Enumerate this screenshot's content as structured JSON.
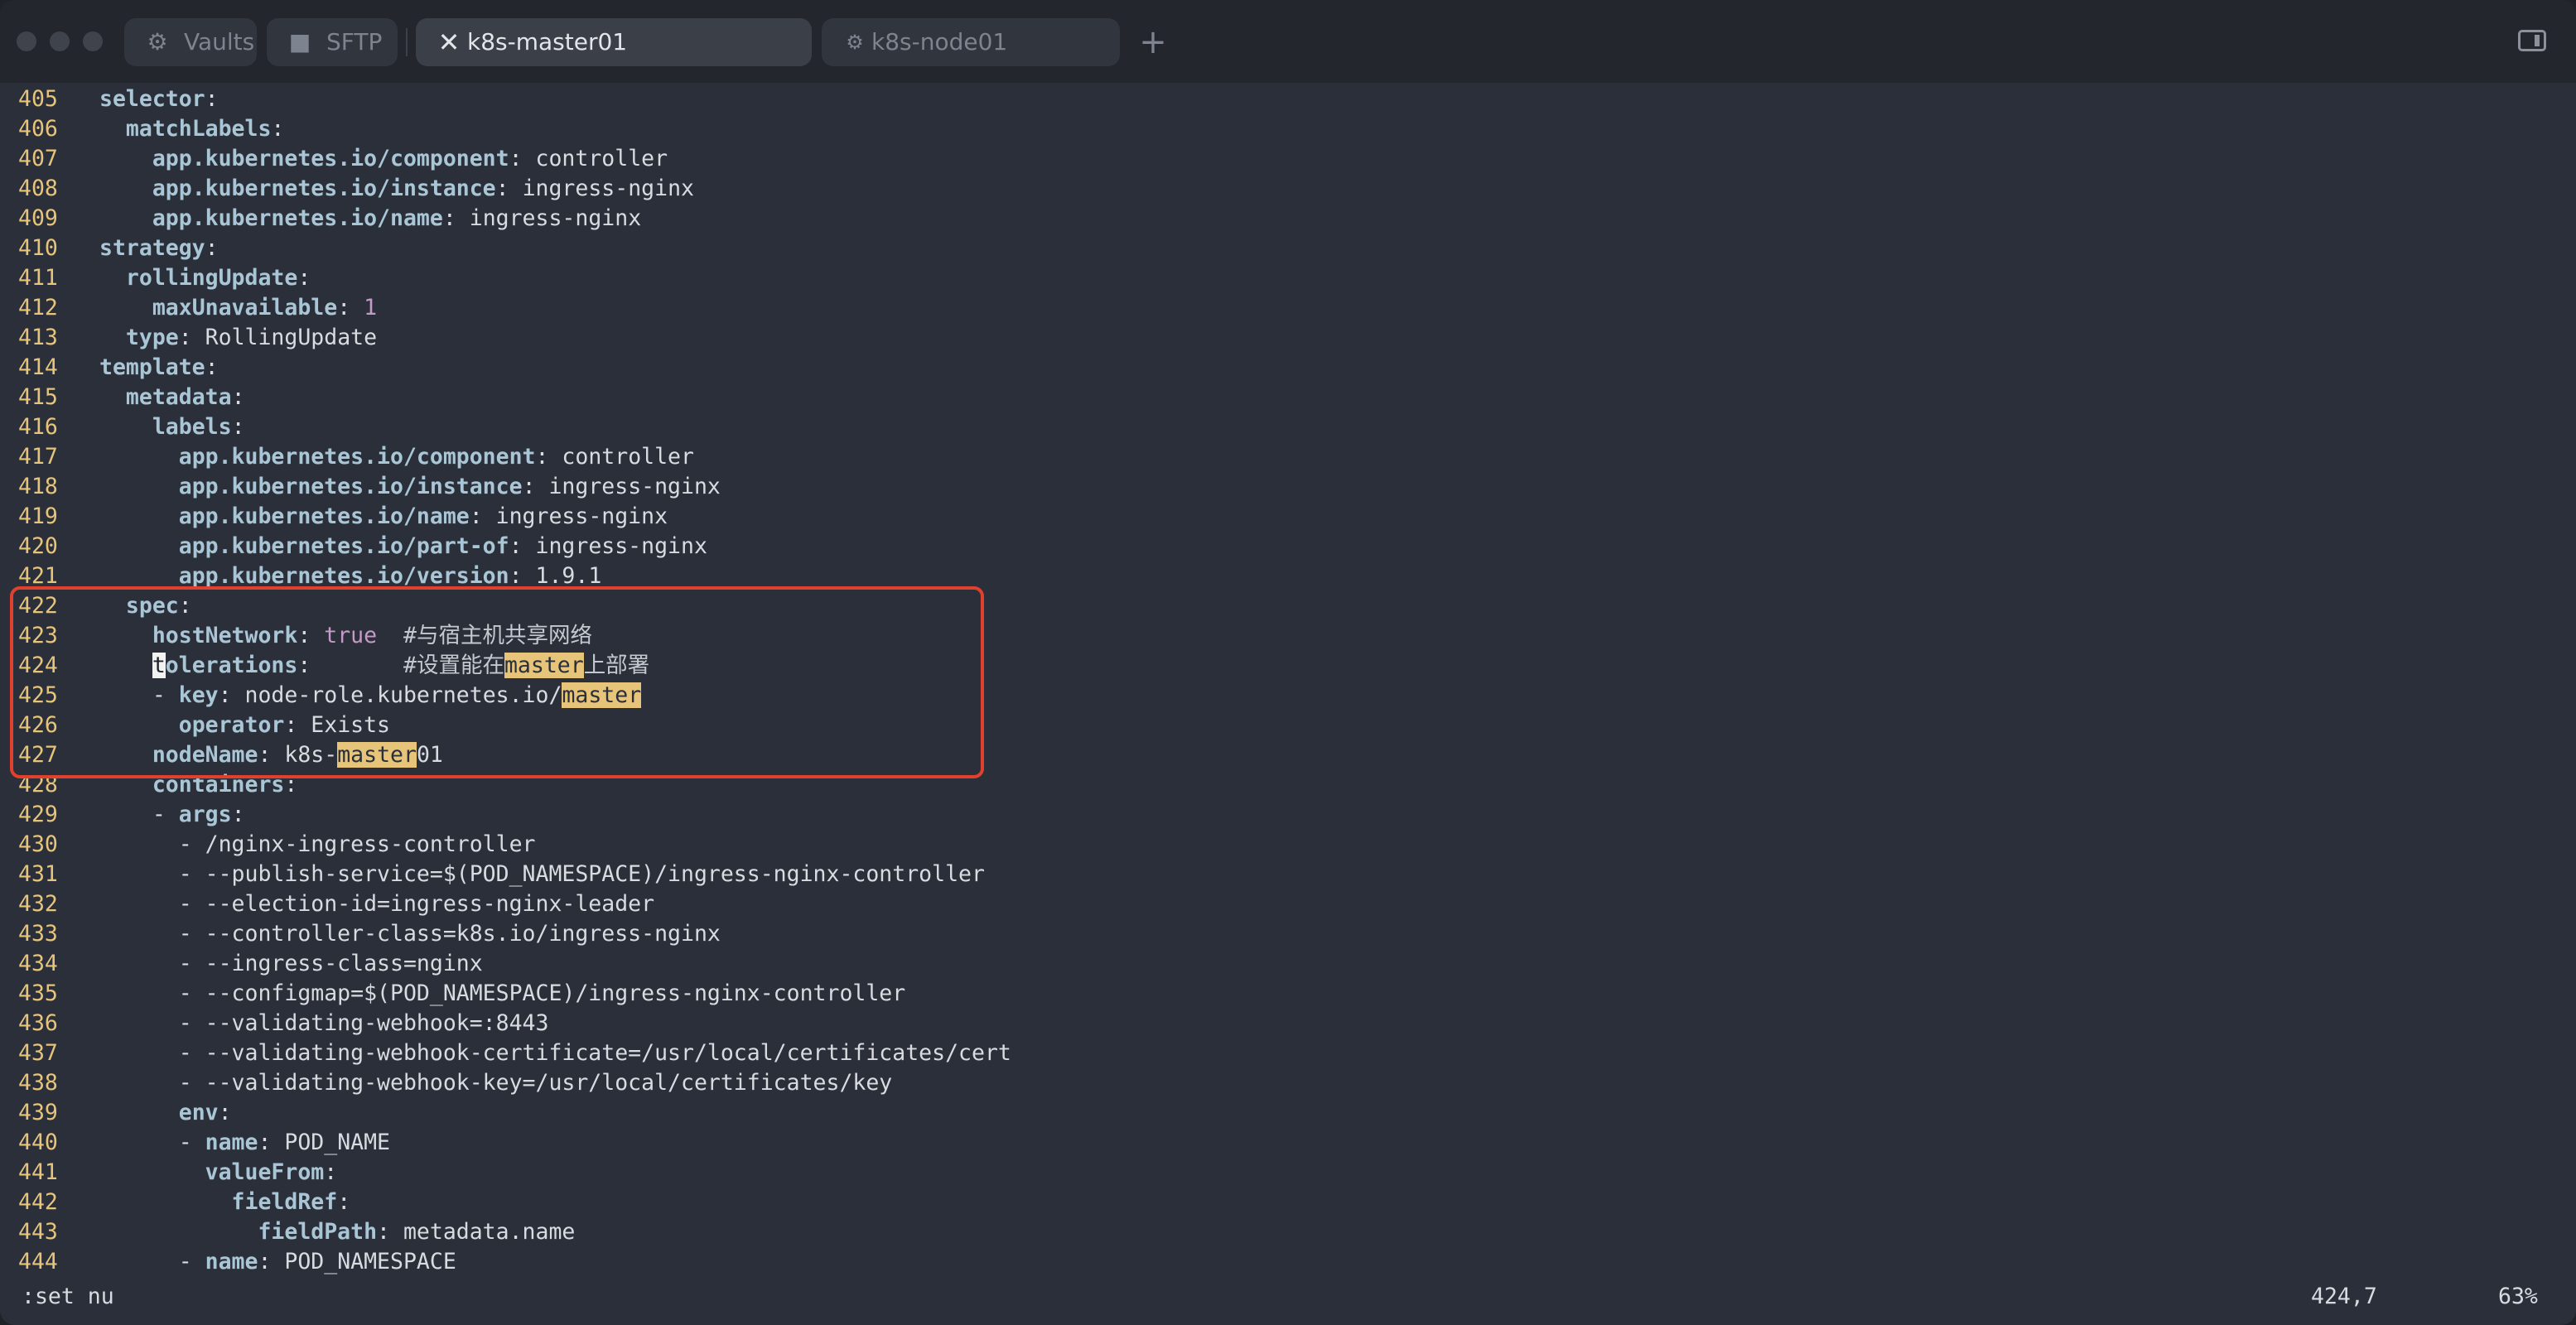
{
  "tabs": [
    {
      "label": "Vaults",
      "icon": "vault-icon"
    },
    {
      "label": "SFTP",
      "icon": "folder-icon"
    },
    {
      "label": "k8s-master01",
      "icon": "close-icon",
      "active": true
    },
    {
      "label": "k8s-node01",
      "icon": "gear-icon"
    }
  ],
  "lines": [
    {
      "n": "405",
      "segs": [
        [
          "k",
          "selector"
        ],
        [
          "p",
          ":"
        ]
      ]
    },
    {
      "n": "406",
      "segs": [
        [
          "p",
          "  "
        ],
        [
          "k",
          "matchLabels"
        ],
        [
          "p",
          ":"
        ]
      ]
    },
    {
      "n": "407",
      "segs": [
        [
          "p",
          "    "
        ],
        [
          "k",
          "app.kubernetes.io/component"
        ],
        [
          "p",
          ": controller"
        ]
      ]
    },
    {
      "n": "408",
      "segs": [
        [
          "p",
          "    "
        ],
        [
          "k",
          "app.kubernetes.io/instance"
        ],
        [
          "p",
          ": ingress-nginx"
        ]
      ]
    },
    {
      "n": "409",
      "segs": [
        [
          "p",
          "    "
        ],
        [
          "k",
          "app.kubernetes.io/name"
        ],
        [
          "p",
          ": ingress-nginx"
        ]
      ]
    },
    {
      "n": "410",
      "segs": [
        [
          "k",
          "strategy"
        ],
        [
          "p",
          ":"
        ]
      ]
    },
    {
      "n": "411",
      "segs": [
        [
          "p",
          "  "
        ],
        [
          "k",
          "rollingUpdate"
        ],
        [
          "p",
          ":"
        ]
      ]
    },
    {
      "n": "412",
      "segs": [
        [
          "p",
          "    "
        ],
        [
          "k",
          "maxUnavailable"
        ],
        [
          "p",
          ": "
        ],
        [
          "num",
          "1"
        ]
      ]
    },
    {
      "n": "413",
      "segs": [
        [
          "p",
          "  "
        ],
        [
          "k",
          "type"
        ],
        [
          "p",
          ": RollingUpdate"
        ]
      ]
    },
    {
      "n": "414",
      "segs": [
        [
          "k",
          "template"
        ],
        [
          "p",
          ":"
        ]
      ]
    },
    {
      "n": "415",
      "segs": [
        [
          "p",
          "  "
        ],
        [
          "k",
          "metadata"
        ],
        [
          "p",
          ":"
        ]
      ]
    },
    {
      "n": "416",
      "segs": [
        [
          "p",
          "    "
        ],
        [
          "k",
          "labels"
        ],
        [
          "p",
          ":"
        ]
      ]
    },
    {
      "n": "417",
      "segs": [
        [
          "p",
          "      "
        ],
        [
          "k",
          "app.kubernetes.io/component"
        ],
        [
          "p",
          ": controller"
        ]
      ]
    },
    {
      "n": "418",
      "segs": [
        [
          "p",
          "      "
        ],
        [
          "k",
          "app.kubernetes.io/instance"
        ],
        [
          "p",
          ": ingress-nginx"
        ]
      ]
    },
    {
      "n": "419",
      "segs": [
        [
          "p",
          "      "
        ],
        [
          "k",
          "app.kubernetes.io/name"
        ],
        [
          "p",
          ": ingress-nginx"
        ]
      ]
    },
    {
      "n": "420",
      "segs": [
        [
          "p",
          "      "
        ],
        [
          "k",
          "app.kubernetes.io/part-of"
        ],
        [
          "p",
          ": ingress-nginx"
        ]
      ]
    },
    {
      "n": "421",
      "segs": [
        [
          "p",
          "      "
        ],
        [
          "k",
          "app.kubernetes.io/version"
        ],
        [
          "p",
          ": 1.9.1"
        ]
      ]
    },
    {
      "n": "422",
      "segs": [
        [
          "p",
          "  "
        ],
        [
          "k",
          "spec"
        ],
        [
          "p",
          ":"
        ]
      ]
    },
    {
      "n": "423",
      "segs": [
        [
          "p",
          "    "
        ],
        [
          "k",
          "hostNetwork"
        ],
        [
          "p",
          ": "
        ],
        [
          "bool",
          "true"
        ],
        [
          "p",
          "  "
        ],
        [
          "c",
          "#与宿主机共享网络"
        ]
      ]
    },
    {
      "n": "424",
      "segs": [
        [
          "p",
          "    "
        ],
        [
          "cur",
          "t"
        ],
        [
          "k",
          "olerations"
        ],
        [
          "p",
          ":       "
        ],
        [
          "c",
          "#设置能在"
        ],
        [
          "hl",
          "master"
        ],
        [
          "c",
          "上部署"
        ]
      ]
    },
    {
      "n": "425",
      "segs": [
        [
          "p",
          "    - "
        ],
        [
          "k",
          "key"
        ],
        [
          "p",
          ": node-role.kubernetes.io/"
        ],
        [
          "hl",
          "master"
        ]
      ]
    },
    {
      "n": "426",
      "segs": [
        [
          "p",
          "      "
        ],
        [
          "k",
          "operator"
        ],
        [
          "p",
          ": Exists"
        ]
      ]
    },
    {
      "n": "427",
      "segs": [
        [
          "p",
          "    "
        ],
        [
          "k",
          "nodeName"
        ],
        [
          "p",
          ": k8s-"
        ],
        [
          "hl",
          "master"
        ],
        [
          "p",
          "01"
        ]
      ]
    },
    {
      "n": "428",
      "segs": [
        [
          "p",
          "    "
        ],
        [
          "k",
          "containers"
        ],
        [
          "p",
          ":"
        ]
      ]
    },
    {
      "n": "429",
      "segs": [
        [
          "p",
          "    - "
        ],
        [
          "k",
          "args"
        ],
        [
          "p",
          ":"
        ]
      ]
    },
    {
      "n": "430",
      "segs": [
        [
          "p",
          "      - /nginx-ingress-controller"
        ]
      ]
    },
    {
      "n": "431",
      "segs": [
        [
          "p",
          "      - --publish-service=$(POD_NAMESPACE)/ingress-nginx-controller"
        ]
      ]
    },
    {
      "n": "432",
      "segs": [
        [
          "p",
          "      - --election-id=ingress-nginx-leader"
        ]
      ]
    },
    {
      "n": "433",
      "segs": [
        [
          "p",
          "      - --controller-class=k8s.io/ingress-nginx"
        ]
      ]
    },
    {
      "n": "434",
      "segs": [
        [
          "p",
          "      - --ingress-class=nginx"
        ]
      ]
    },
    {
      "n": "435",
      "segs": [
        [
          "p",
          "      - --configmap=$(POD_NAMESPACE)/ingress-nginx-controller"
        ]
      ]
    },
    {
      "n": "436",
      "segs": [
        [
          "p",
          "      - --validating-webhook=:8443"
        ]
      ]
    },
    {
      "n": "437",
      "segs": [
        [
          "p",
          "      - --validating-webhook-certificate=/usr/local/certificates/cert"
        ]
      ]
    },
    {
      "n": "438",
      "segs": [
        [
          "p",
          "      - --validating-webhook-key=/usr/local/certificates/key"
        ]
      ]
    },
    {
      "n": "439",
      "segs": [
        [
          "p",
          "      "
        ],
        [
          "k",
          "env"
        ],
        [
          "p",
          ":"
        ]
      ]
    },
    {
      "n": "440",
      "segs": [
        [
          "p",
          "      - "
        ],
        [
          "k",
          "name"
        ],
        [
          "p",
          ": POD_NAME"
        ]
      ]
    },
    {
      "n": "441",
      "segs": [
        [
          "p",
          "        "
        ],
        [
          "k",
          "valueFrom"
        ],
        [
          "p",
          ":"
        ]
      ]
    },
    {
      "n": "442",
      "segs": [
        [
          "p",
          "          "
        ],
        [
          "k",
          "fieldRef"
        ],
        [
          "p",
          ":"
        ]
      ]
    },
    {
      "n": "443",
      "segs": [
        [
          "p",
          "            "
        ],
        [
          "k",
          "fieldPath"
        ],
        [
          "p",
          ": metadata.name"
        ]
      ]
    },
    {
      "n": "444",
      "segs": [
        [
          "p",
          "      - "
        ],
        [
          "k",
          "name"
        ],
        [
          "p",
          ": POD_NAMESPACE"
        ]
      ]
    }
  ],
  "status": {
    "command": ":set nu",
    "position": "424,7",
    "percent": "63%"
  },
  "colors": {
    "background": "#2b2f39",
    "line_number": "#e6c47a",
    "key": "#a9c6d6",
    "search_highlight": "#e6c47a",
    "annotation_box": "#e0412e"
  }
}
